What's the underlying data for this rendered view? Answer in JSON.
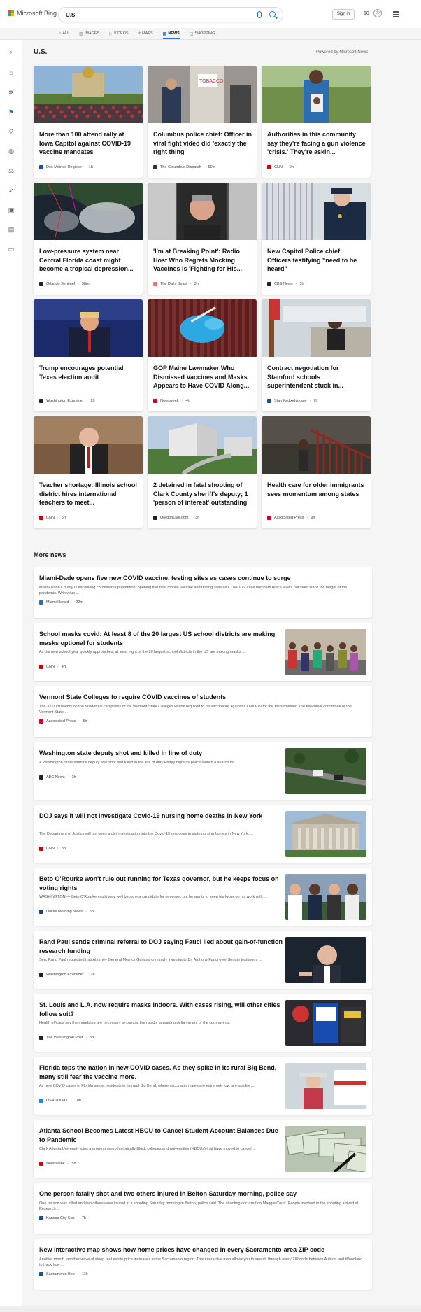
{
  "brand": {
    "name": "Microsoft Bing"
  },
  "search": {
    "query": "U.S."
  },
  "header": {
    "signin": "Sign in",
    "points": "10"
  },
  "tabs": [
    {
      "label": "ALL",
      "icon": "search-icon"
    },
    {
      "label": "IMAGES",
      "icon": "image-icon"
    },
    {
      "label": "VIDEOS",
      "icon": "video-icon"
    },
    {
      "label": "MAPS",
      "icon": "map-icon"
    },
    {
      "label": "NEWS",
      "icon": "news-icon",
      "active": true
    },
    {
      "label": "SHOPPING",
      "icon": "bag-icon"
    }
  ],
  "section": {
    "title": "U.S.",
    "powered": "Powered by Microsoft News"
  },
  "top_stories": [
    {
      "title": "More than 100 attend rally at Iowa Capitol against COVID-19 vaccine mandates",
      "source": "Des Moines Register",
      "age": "1h",
      "logo_color": "#1e4d9c"
    },
    {
      "title": "Columbus police chief: Officer in viral fight video did 'exactly the right thing'",
      "source": "The Columbus Dispatch",
      "age": "50m",
      "logo_color": "#333333"
    },
    {
      "title": "Authorities in this community say they're facing a gun violence 'crisis.' They're askin...",
      "source": "CNN",
      "age": "9h",
      "logo_color": "#cc0000"
    },
    {
      "title": "Low-pressure system near Central Florida coast might become a tropical depression...",
      "source": "Orlando Sentinel",
      "age": "58m",
      "logo_color": "#222222"
    },
    {
      "title": "'I'm at Breaking Point': Radio Host Who Regrets Mocking Vaccines Is 'Fighting for His...",
      "source": "The Daily Beast",
      "age": "3h",
      "logo_color": "#e8716f"
    },
    {
      "title": "New Capitol Police chief: Officers testifying \"need to be heard\"",
      "source": "CBS News",
      "age": "3h",
      "logo_color": "#222222"
    },
    {
      "title": "Trump encourages potential Texas election audit",
      "source": "Washington Examiner",
      "age": "2h",
      "logo_color": "#222222"
    },
    {
      "title": "GOP Maine Lawmaker Who Dismissed Vaccines and Masks Appears to Have COVID Along...",
      "source": "Newsweek",
      "age": "4h",
      "logo_color": "#d0021b"
    },
    {
      "title": "Contract negotiation for Stamford schools superintendent stuck in...",
      "source": "Stamford Advocate",
      "age": "7h",
      "logo_color": "#1c4e8f"
    },
    {
      "title": "Teacher shortage: Illinois school district hires international teachers to meet...",
      "source": "CNN",
      "age": "5h",
      "logo_color": "#cc0000"
    },
    {
      "title": "2 detained in fatal shooting of Clark County sheriff's deputy; 1 'person of interest' outstanding",
      "source": "OregonLive.com",
      "age": "3h",
      "logo_color": "#222222"
    },
    {
      "title": "Health care for older immigrants sees momentum among states",
      "source": "Associated Press",
      "age": "9h",
      "logo_color": "#d0021b"
    }
  ],
  "more_news_title": "More news",
  "more_news": [
    {
      "title": "Miami-Dade opens five new COVID vaccine, testing sites as cases continue to surge",
      "snippet": "Miami-Dade County is escalating coronavirus prevention, opening five new mobile vaccine and testing sites as COVID-19 case numbers reach levels not seen since the height of the pandemic. With virus ...",
      "source": "Miami Herald",
      "age": "22m",
      "logo_color": "#2a6ebb",
      "image": false
    },
    {
      "title": "School masks covid: At least 8 of the 20 largest US school districts are making masks optional for students",
      "snippet": "As the new school year quickly approaches, at least eight of the 20 largest school districts in the US are making masks ...",
      "source": "CNN",
      "age": "4h",
      "logo_color": "#cc0000",
      "image": true
    },
    {
      "title": "Vermont State Colleges to require COVID vaccines of students",
      "snippet": "The 3,000 students on the residential campuses of the Vermont State Colleges will be required to be vaccinated against COVID-19 for the fall semester. The executive committee of the Vermont State ...",
      "source": "Associated Press",
      "age": "5h",
      "logo_color": "#d0021b",
      "image": false
    },
    {
      "title": "Washington state deputy shot and killed in line of duty",
      "snippet": "A Washington State sheriff's deputy was shot and killed in the line of duty Friday night as police launch a search for ...",
      "source": "ABC News",
      "age": "1h",
      "logo_color": "#222222",
      "image": true
    },
    {
      "title": "DOJ says it will not investigate Covid-19 nursing home deaths in New York",
      "snippet": "The Department of Justice will not open a civil investigation into the Covid-19 response in state nursing homes in New York, ...",
      "source": "CNN",
      "age": "8h",
      "logo_color": "#cc0000",
      "image": true
    },
    {
      "title": "Beto O'Rourke won't rule out running for Texas governor, but he keeps focus on voting rights",
      "snippet": "WASHINGTON — Beto O'Rourke might very well become a candidate for governor, but he wants to keep his focus on his work with ...",
      "source": "Dallas Morning News",
      "age": "6h",
      "logo_color": "#1c3f7a",
      "image": true
    },
    {
      "title": "Rand Paul sends criminal referral to DOJ saying Fauci lied about gain-of-function research funding",
      "snippet": "Sen. Rand Paul requested that Attorney General Merrick Garland criminally investigate Dr. Anthony Fauci over Senate testimony ...",
      "source": "Washington Examiner",
      "age": "2h",
      "logo_color": "#222222",
      "image": true
    },
    {
      "title": "St. Louis and L.A. now require masks indoors. With cases rising, will other cities follow suit?",
      "snippet": "Health officials say the mandates are necessary to combat the rapidly spreading delta variant of the coronavirus.",
      "source": "The Washington Post",
      "age": "5h",
      "logo_color": "#222222",
      "image": true
    },
    {
      "title": "Florida tops the nation in new COVID cases. As they spike in its rural Big Bend, many still fear the vaccine more.",
      "snippet": "As new COVID cases in Florida surge, residents in its rural Big Bend, where vaccination rates are extremely low, are quickly ...",
      "source": "USA TODAY",
      "age": "10h",
      "logo_color": "#1e88e5",
      "image": true
    },
    {
      "title": "Atlanta School Becomes Latest HBCU to Cancel Student Account Balances Due to Pandemic",
      "snippet": "Clark Atlanta University joins a growing group historically Black colleges and universities (HBCUs) that have moved to cancel ...",
      "source": "Newsweek",
      "age": "5h",
      "logo_color": "#d0021b",
      "image": true
    },
    {
      "title": "One person fatally shot and two others injured in Belton Saturday morning, police say",
      "snippet": "One person was killed and two others were injured in a shooting Saturday morning in Belton, police said. The shooting occurred on Maggie Court. People involved in the shooting arrived at Research ...",
      "source": "Kansas City Star",
      "age": "7h",
      "logo_color": "#1c4e8f",
      "image": false
    },
    {
      "title": "New interactive map shows how home prices have changed in every Sacramento-area ZIP code",
      "snippet": "Another month, another wave of steep real estate price increases in the Sacramento region. This interactive map allows you to search through every ZIP code between Auburn and Woodland to track how ...",
      "source": "Sacramento Bee",
      "age": "11h",
      "logo_color": "#1c4e8f",
      "image": false
    }
  ]
}
